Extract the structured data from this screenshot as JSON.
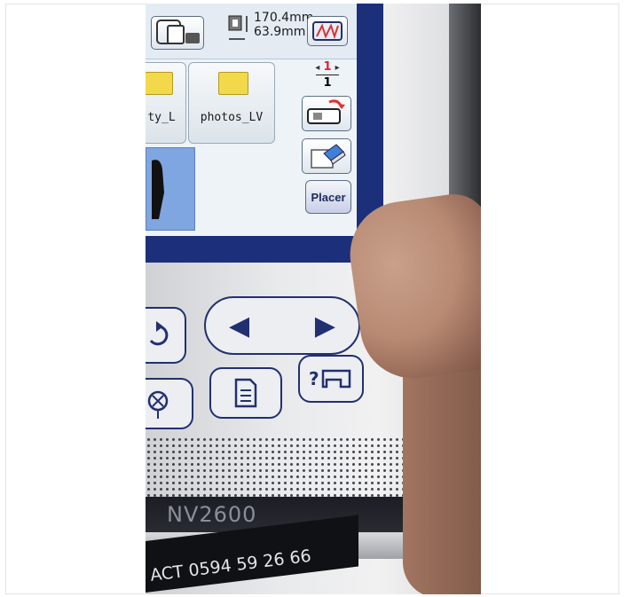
{
  "screen": {
    "dimensions": {
      "width_text": "170.4mm",
      "height_text": "63.9mm"
    },
    "files": [
      {
        "label": "ty_L"
      },
      {
        "label": "photos_LV"
      }
    ],
    "page_nav": {
      "current": "1",
      "total": "1"
    },
    "placer_label": "Placer"
  },
  "machine": {
    "model": "NV2600",
    "contact_label": "ACT 0594 59 26 66"
  },
  "colors": {
    "bezel": "#1c2f7a",
    "screen": "#eef3f8",
    "folder": "#f1d94a",
    "button_border": "#223070"
  },
  "icons": {
    "frame_select": "frame-select-icon",
    "size": "pattern-size-icon",
    "embroidery": "embroidery-mode-icon",
    "send_to_machine": "send-to-machine-icon",
    "delete": "eraser-icon",
    "rotate": "rotate-icon",
    "left": "arrow-left-icon",
    "right": "arrow-right-icon",
    "threading": "needle-icon",
    "memory": "memory-icon",
    "help": "help-sewing-icon"
  }
}
